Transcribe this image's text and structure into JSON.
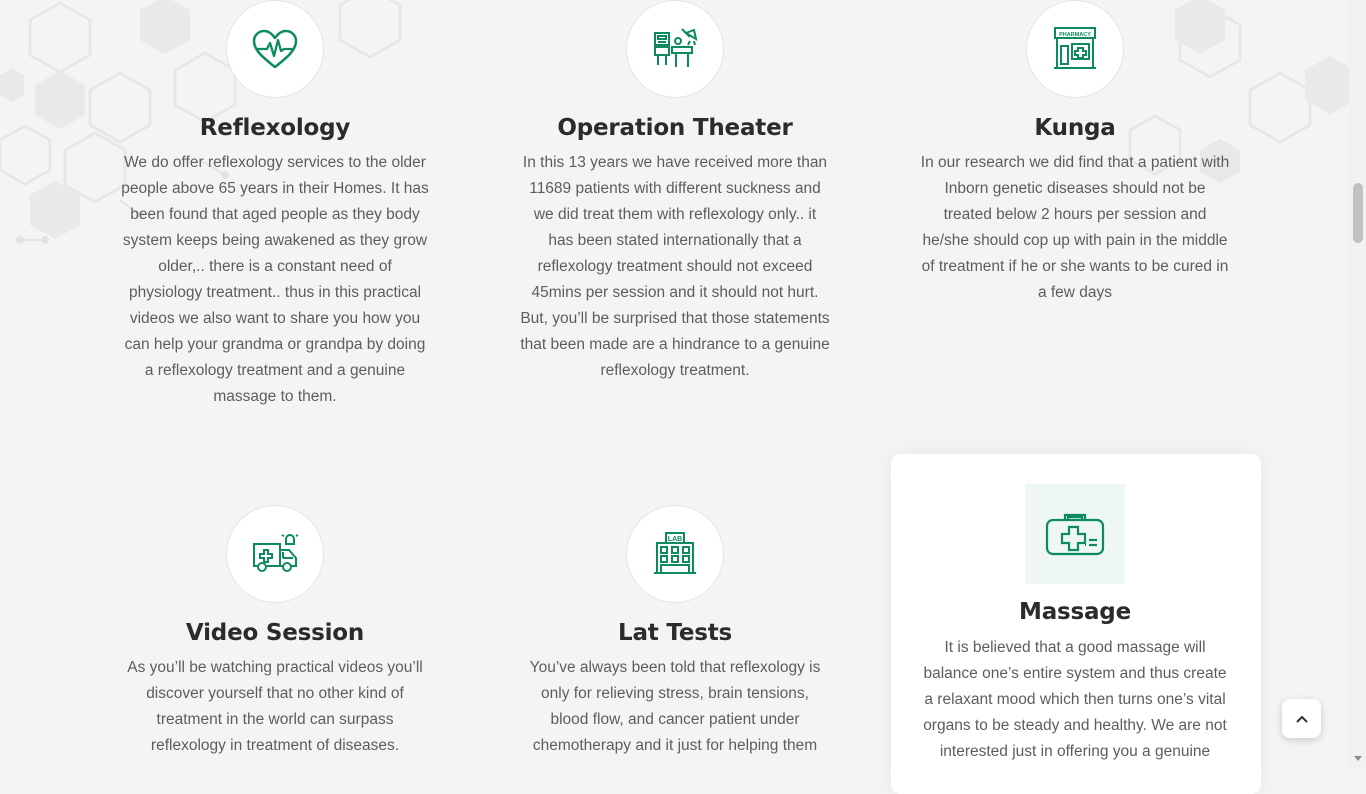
{
  "colors": {
    "accent": "#0e8a5f",
    "background": "#f4f4f4",
    "heading": "#2b2b2b",
    "text": "#5d5d5d"
  },
  "services": [
    {
      "title": "Reflexology",
      "icon": "heart-pulse-icon",
      "text": "We do offer reflexology services to the older people above 65 years in their Homes. It has been found that aged people as they body system keeps being awakened as they grow older,.. there is a constant need of physiology treatment.. thus in this practical videos we also want to share you how you can help your grandma or grandpa by doing a reflexology treatment and a genuine massage to them."
    },
    {
      "title": "Operation Theater",
      "icon": "operating-room-icon",
      "text": "In this 13 years we have received more than 11689 patients with different suckness and we did treat them with reflexology only.. it has been stated internationally that a reflexology treatment should not exceed 45mins per session and it should not hurt. But, you’ll be surprised that those statements that been made are a hindrance to a genuine reflexology treatment."
    },
    {
      "title": "Kunga",
      "icon": "pharmacy-icon",
      "icon_label": "PHARMACY",
      "text": "In our research we did find that a patient with Inborn genetic diseases should not be treated below 2 hours per session and he/she should cop up with pain in the middle of treatment if he or she wants to be cured in a few days"
    },
    {
      "title": "Video Session",
      "icon": "ambulance-icon",
      "text": "As you’ll be watching practical videos you’ll discover yourself that no other kind of treatment in the world can surpass reflexology in treatment of diseases."
    },
    {
      "title": "Lat Tests",
      "icon": "lab-building-icon",
      "icon_label": "LAB",
      "text": "You’ve always been told that reflexology is only for relieving stress, brain tensions, blood flow, and cancer patient under chemotherapy and it just for helping them"
    },
    {
      "title": "Massage",
      "icon": "first-aid-kit-icon",
      "text": "It is believed that a good massage will balance one’s entire system and thus create a relaxant mood which then turns one’s vital organs to be steady and healthy. We are not interested just in offering you a genuine"
    }
  ],
  "scroll_top": {
    "icon": "chevron-up-icon"
  }
}
